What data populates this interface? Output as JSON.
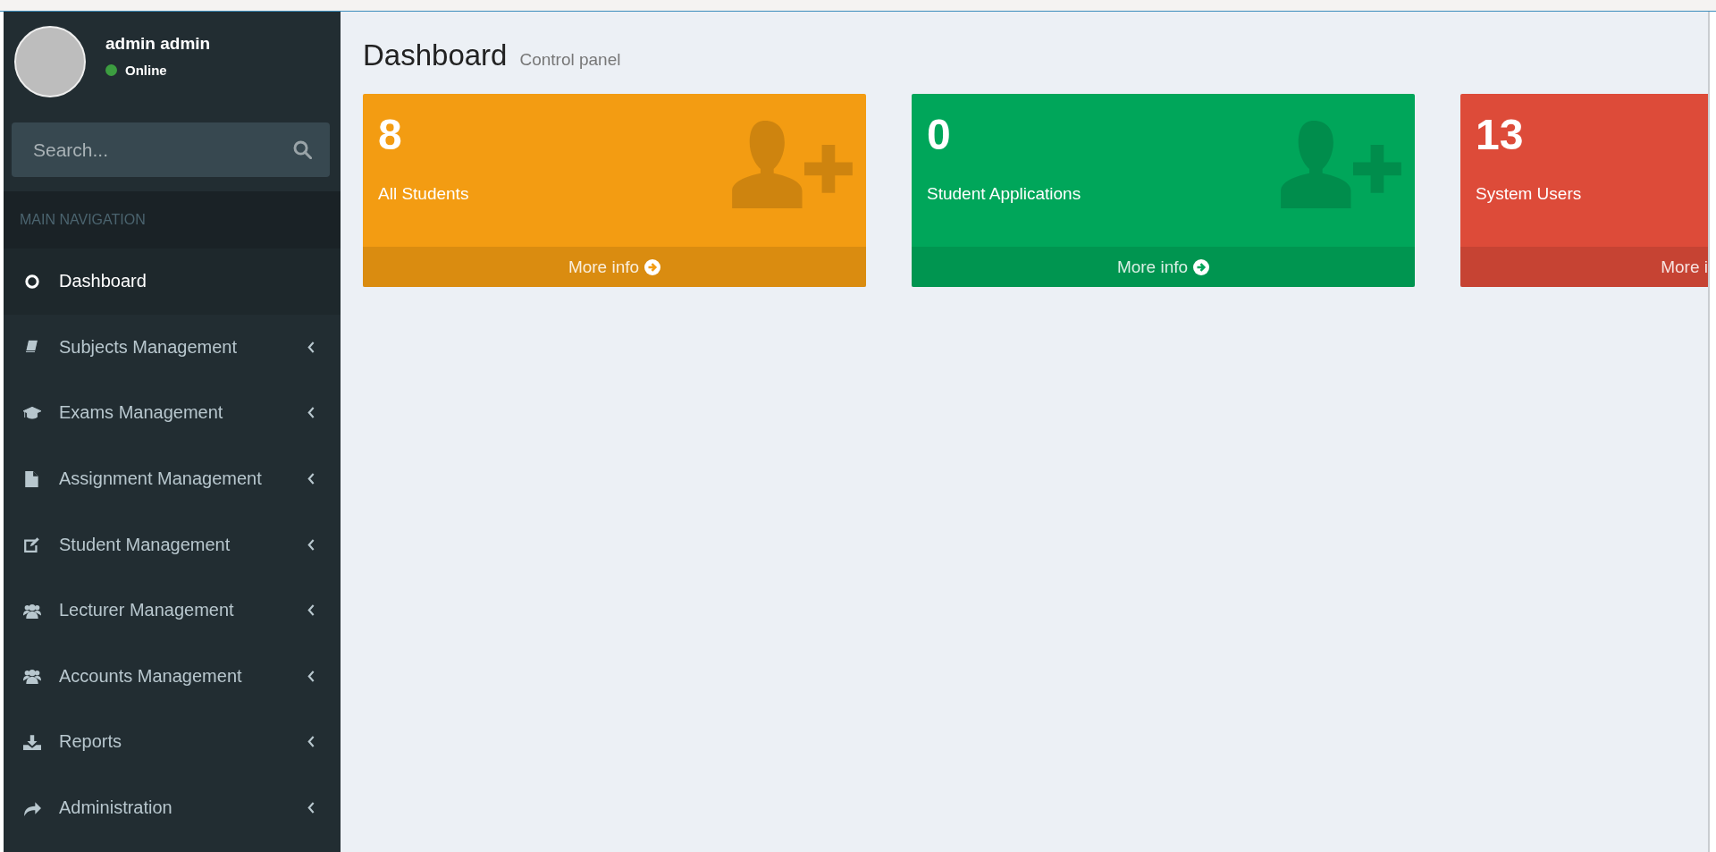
{
  "user": {
    "name": "admin admin",
    "status": "Online"
  },
  "search": {
    "placeholder": "Search..."
  },
  "nav_header": "MAIN NAVIGATION",
  "nav": [
    {
      "label": "Dashboard",
      "kind": "circle",
      "selected": true,
      "has_caret": false
    },
    {
      "label": "Subjects Management",
      "kind": "book",
      "selected": false,
      "has_caret": true
    },
    {
      "label": "Exams Management",
      "kind": "cap",
      "selected": false,
      "has_caret": true
    },
    {
      "label": "Assignment Management",
      "kind": "file",
      "selected": false,
      "has_caret": true
    },
    {
      "label": "Student Management",
      "kind": "edit",
      "selected": false,
      "has_caret": true
    },
    {
      "label": "Lecturer Management",
      "kind": "users",
      "selected": false,
      "has_caret": true
    },
    {
      "label": "Accounts Management",
      "kind": "users",
      "selected": false,
      "has_caret": true
    },
    {
      "label": "Reports",
      "kind": "download",
      "selected": false,
      "has_caret": true
    },
    {
      "label": "Administration",
      "kind": "share",
      "selected": false,
      "has_caret": true
    }
  ],
  "page": {
    "title": "Dashboard",
    "subtitle": "Control panel"
  },
  "cards": [
    {
      "value": "8",
      "label": "All Students",
      "footer": "More info",
      "color": "#f39c12",
      "clipped": false
    },
    {
      "value": "0",
      "label": "Student Applications",
      "footer": "More info",
      "color": "#00a65a",
      "clipped": false
    },
    {
      "value": "13",
      "label": "System Users",
      "footer": "More i",
      "color": "#dd4b39",
      "clipped": true
    }
  ]
}
